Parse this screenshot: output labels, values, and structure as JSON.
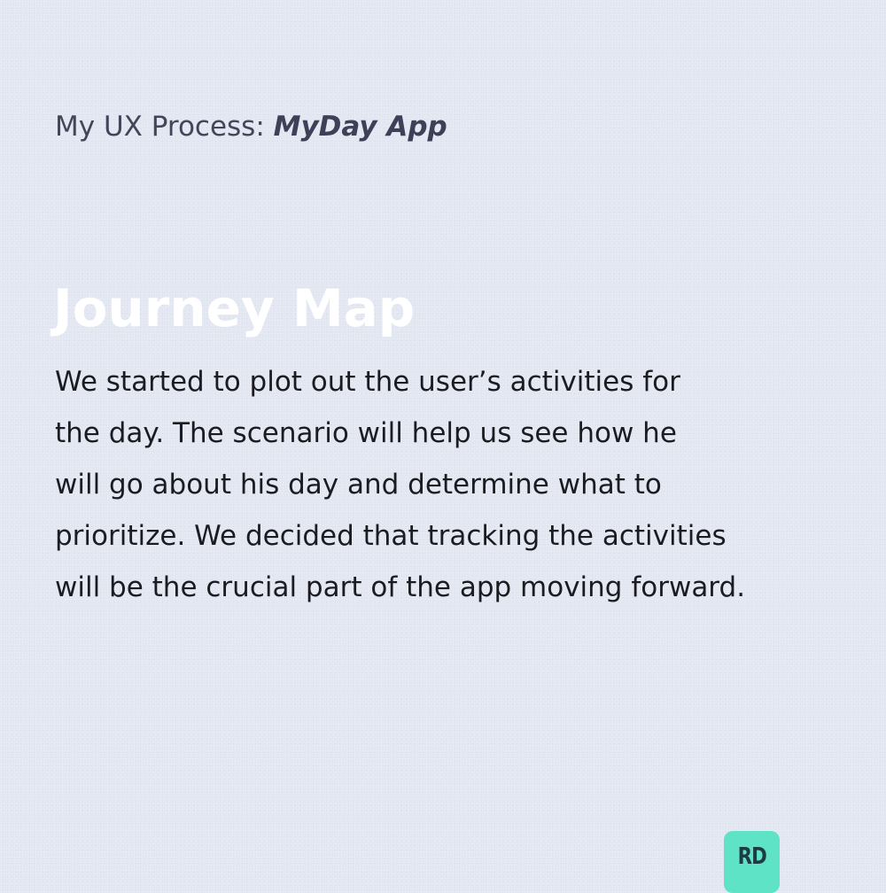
{
  "header": {
    "prefix": "My UX Process: ",
    "app_name": "MyDay App"
  },
  "title": "Journey Map",
  "body_lines": [
    "We started to plot out the user’s activities for",
    "the day. The scenario will help us see how he",
    "will go about his day and determine what to",
    "prioritize. We decided that tracking the activities",
    "will be the crucial part of the app moving forward."
  ],
  "logo": {
    "text": "RD",
    "color": "#5fe3c6"
  },
  "colors": {
    "background": "#e3e7f1",
    "title": "#ffffff",
    "body": "#1b1c22"
  }
}
